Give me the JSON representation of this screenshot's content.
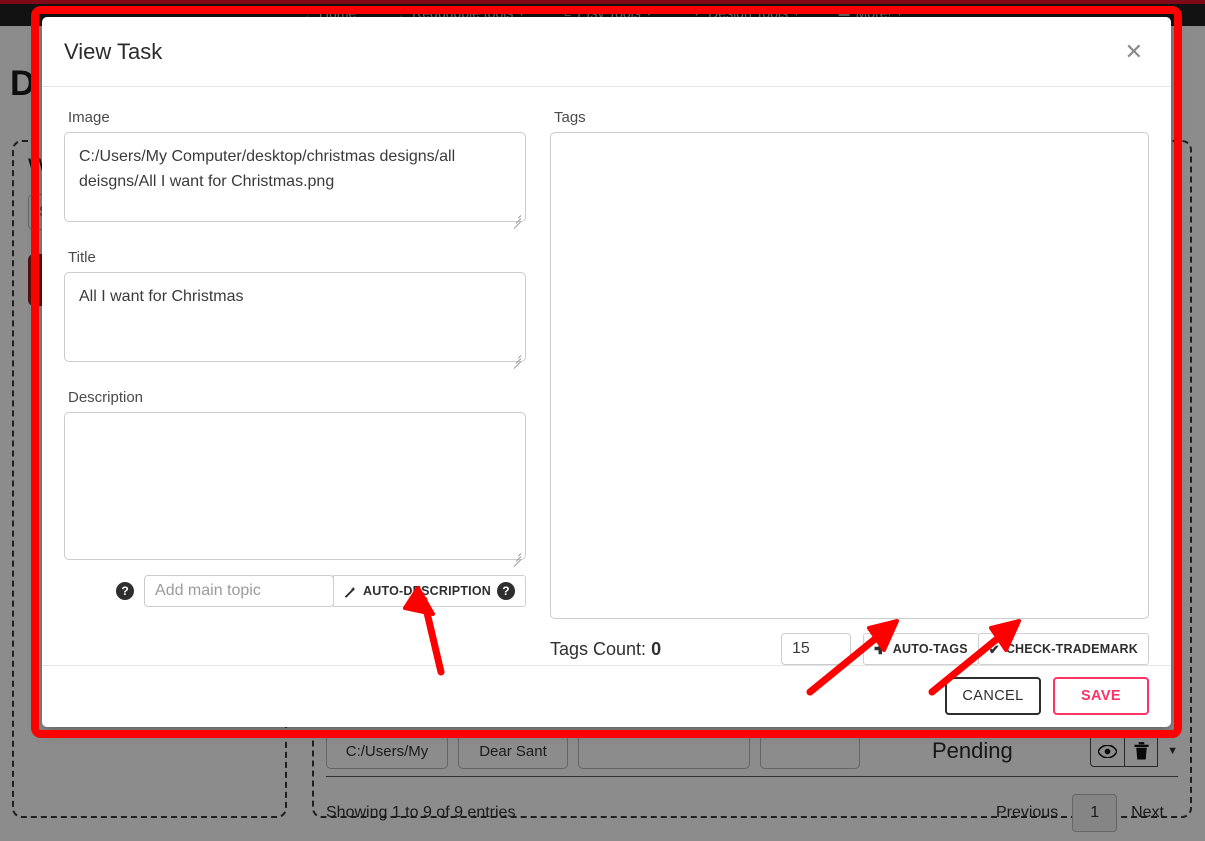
{
  "background": {
    "navbar": {
      "items": [
        {
          "icon": "home-icon",
          "glyph": "⌂",
          "label": "Home",
          "caret": ""
        },
        {
          "icon": "shirt-icon",
          "glyph": "\u0001F455",
          "label": "Redbubble tools",
          "caret": "▾"
        },
        {
          "icon": "etsy-icon",
          "glyph": "E",
          "label": "Etsy Tools",
          "caret": "▾"
        },
        {
          "icon": "design-icon",
          "glyph": "▼",
          "label": "Design Tools",
          "caret": "▾"
        },
        {
          "icon": "more-icon",
          "glyph": "▬",
          "label": "More!",
          "caret": "▾"
        }
      ]
    },
    "page_title": "D",
    "left_panel": {
      "heading": "W",
      "field_value": "S",
      "button_label": ""
    },
    "table": {
      "row": {
        "path": "C:/Users/My",
        "title": "Dear Sant",
        "blank1": "",
        "blank2": "",
        "status": "Pending",
        "view_icon": "eye-icon",
        "delete_icon": "trash-icon",
        "caret_icon": "chevron-down-icon"
      },
      "footer": {
        "info": "Showing 1 to 9 of 9 entries",
        "previous": "Previous",
        "page": "1",
        "next": "Next"
      }
    }
  },
  "modal": {
    "title": "View Task",
    "close_icon": "close-icon",
    "image": {
      "label": "Image",
      "value": "C:/Users/My Computer/desktop/christmas designs/all deisgns/All I want for Christmas.png"
    },
    "title_field": {
      "label": "Title",
      "value": "All I want for Christmas"
    },
    "description": {
      "label": "Description",
      "value": "",
      "help_icon": "help-circle-icon",
      "topic_placeholder": "Add main topic",
      "topic_value": "",
      "auto_button": {
        "icon": "magic-wand-icon",
        "label": "AUTO-DESCRIPTION",
        "help_icon": "help-circle-icon"
      }
    },
    "tags": {
      "label": "Tags",
      "value": "",
      "count_label": "Tags Count:",
      "count_value": "0",
      "count_input": "15",
      "auto_tags_button": {
        "icon": "plus-icon",
        "glyph": "✚",
        "label": "AUTO-TAGS"
      },
      "check_trademark_button": {
        "icon": "check-icon",
        "glyph": "✔",
        "label": "CHECK-TRADEMARK"
      }
    },
    "footer": {
      "cancel_label": "CANCEL",
      "save_label": "SAVE"
    }
  },
  "annotations": {
    "highlight_color": "#ff0000",
    "arrows": [
      {
        "name": "arrow-to-auto-description",
        "target": "AUTO-DESCRIPTION"
      },
      {
        "name": "arrow-to-auto-tags",
        "target": "AUTO-TAGS"
      },
      {
        "name": "arrow-to-check-trademark",
        "target": "CHECK-TRADEMARK"
      }
    ]
  },
  "colors": {
    "brand_red": "#e8112d",
    "save_pink": "#ff3366",
    "navbar_dark": "#212121"
  }
}
